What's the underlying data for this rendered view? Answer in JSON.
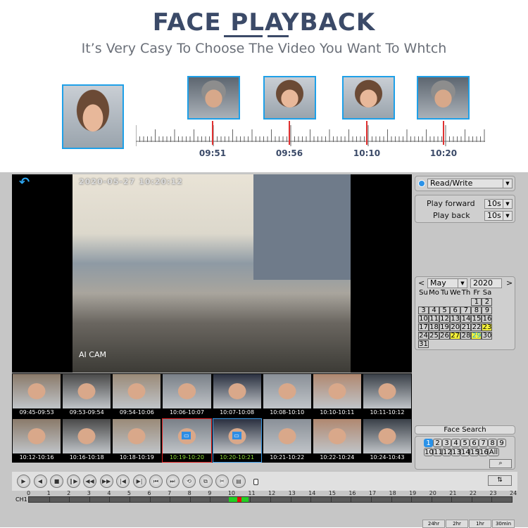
{
  "header": {
    "title": "FACE PLAYBACK",
    "subtitle": "It’s Very Casy To Choose The Video You Want To Whtch"
  },
  "face_timeline": {
    "markers": [
      "09:51",
      "09:56",
      "10:10",
      "10:20"
    ]
  },
  "video": {
    "osd": "2020-05-27 10:20:12",
    "watermark": "AI CAM",
    "back_icon": "back-arrow-icon"
  },
  "thumbnails": [
    {
      "time": "09:45-09:53"
    },
    {
      "time": "09:53-09:54"
    },
    {
      "time": "09:54-10:06"
    },
    {
      "time": "10:06-10:07"
    },
    {
      "time": "10:07-10:08"
    },
    {
      "time": "10:08-10:10"
    },
    {
      "time": "10:10-10:11"
    },
    {
      "time": "10:11-10:12"
    },
    {
      "time": "10:12-10:16"
    },
    {
      "time": "10:16-10:18"
    },
    {
      "time": "10:18-10:19"
    },
    {
      "time": "10:19-10:20",
      "state": "red"
    },
    {
      "time": "10:20-10:21",
      "state": "blue"
    },
    {
      "time": "10:21-10:22"
    },
    {
      "time": "10:22-10:24"
    },
    {
      "time": "10:24-10:43"
    }
  ],
  "side": {
    "mode": "Read/Write",
    "play_forward_label": "Play forward",
    "play_forward_value": "10s",
    "play_back_label": "Play back",
    "play_back_value": "10s",
    "calendar": {
      "prev": "<",
      "next": ">",
      "month": "May",
      "year": "2020",
      "weekdays": [
        "Su",
        "Mo",
        "Tu",
        "We",
        "Th",
        "Fr",
        "Sa"
      ],
      "first_weekday": 5,
      "days": 31,
      "highlight_yellow": [
        23,
        27
      ],
      "highlight_selected": 29
    },
    "face_search": {
      "title": "Face Search",
      "channels": [
        "1",
        "2",
        "3",
        "4",
        "5",
        "6",
        "7",
        "8",
        "9",
        "10",
        "11",
        "12",
        "13",
        "14",
        "15",
        "16"
      ],
      "all_label": "All",
      "selected": "1"
    }
  },
  "timeline": {
    "channel": "CH1",
    "hours": [
      "0",
      "1",
      "2",
      "3",
      "4",
      "5",
      "6",
      "7",
      "8",
      "9",
      "10",
      "11",
      "12",
      "13",
      "14",
      "15",
      "16",
      "17",
      "18",
      "19",
      "20",
      "21",
      "22",
      "23",
      "24"
    ],
    "records": [
      {
        "start": 9.95,
        "end": 10.35,
        "color": "#22d022"
      },
      {
        "start": 10.35,
        "end": 10.55,
        "color": "#e01010"
      },
      {
        "start": 10.55,
        "end": 10.9,
        "color": "#22d022"
      }
    ]
  },
  "zoom_buttons": [
    "24hr",
    "2hr",
    "1hr",
    "30min"
  ],
  "colors": {
    "accent": "#1ea0e8",
    "marker": "#e03030",
    "title": "#3b4a68"
  }
}
